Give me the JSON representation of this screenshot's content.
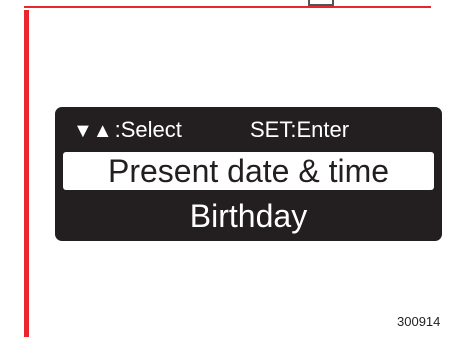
{
  "screen": {
    "hint": {
      "arrows_icon": "down-up-triangles",
      "arrows_text": "▼▲",
      "select_label": ":Select",
      "enter_label": "SET:Enter"
    },
    "menu": [
      {
        "label": "Present date & time",
        "selected": true
      },
      {
        "label": "Birthday",
        "selected": false
      }
    ]
  },
  "figure_id": "300914",
  "colors": {
    "accent": "#e8262b",
    "display_bg": "#231f20",
    "display_text": "#ffffff",
    "highlight_bg": "#ffffff"
  }
}
